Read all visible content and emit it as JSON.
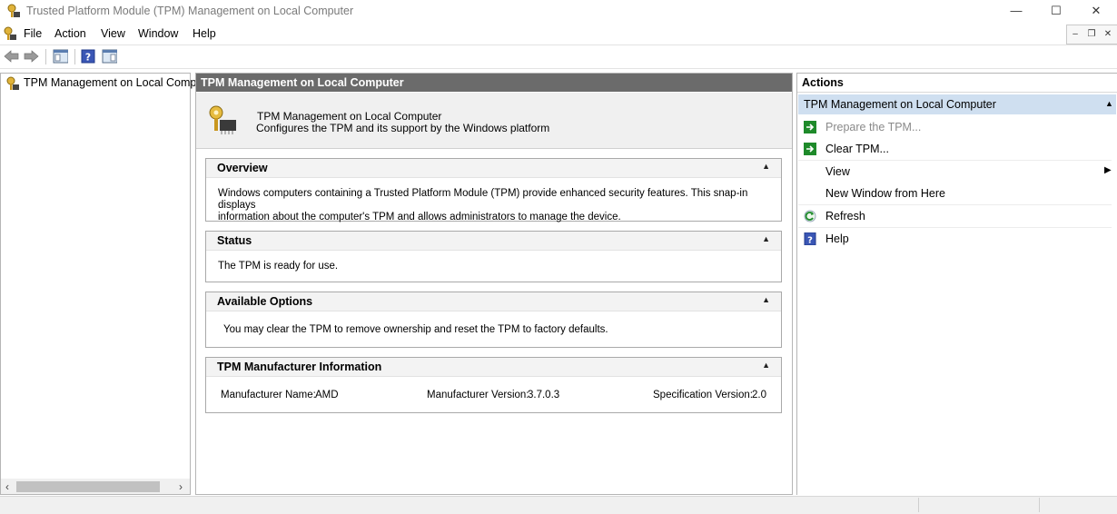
{
  "window": {
    "title": "Trusted Platform Module (TPM) Management on Local Computer",
    "minimize": "—",
    "maximize": "☐",
    "close": "✕"
  },
  "menu": [
    "File",
    "Action",
    "View",
    "Window",
    "Help"
  ],
  "mdi": {
    "minimize": "–",
    "restore": "❐",
    "close": "✕"
  },
  "tree": {
    "root_label": "TPM Management on Local Comp"
  },
  "center": {
    "header": "TPM Management on Local Computer",
    "banner_title": "TPM Management on Local Computer",
    "banner_desc": "Configures the TPM and its support by the Windows platform",
    "sections": {
      "overview": {
        "title": "Overview",
        "line1": "Windows computers containing a Trusted Platform Module (TPM) provide enhanced security features. This snap-in displays",
        "line2": "information about the computer's TPM and allows administrators to manage the device."
      },
      "status": {
        "title": "Status",
        "text": "The TPM is ready for use."
      },
      "options": {
        "title": "Available Options",
        "text": "You may clear the TPM to remove ownership and reset the TPM to factory defaults."
      },
      "manufacturer": {
        "title": "TPM Manufacturer Information",
        "name_label": "Manufacturer Name:",
        "name_value": "AMD",
        "version_label": "Manufacturer Version:",
        "version_value": "3.7.0.3",
        "spec_label": "Specification Version:",
        "spec_value": "2.0"
      }
    }
  },
  "actions": {
    "header": "Actions",
    "group": "TPM Management on Local Computer",
    "items": {
      "prepare": "Prepare the TPM...",
      "clear": "Clear TPM...",
      "view": "View",
      "new_window": "New Window from Here",
      "refresh": "Refresh",
      "help": "Help"
    }
  },
  "colors": {
    "accent_header": "#6b6b6b",
    "actions_group": "#cfdff0",
    "disabled_text": "#8a8a8a",
    "green_icon": "#1e8a2a"
  }
}
